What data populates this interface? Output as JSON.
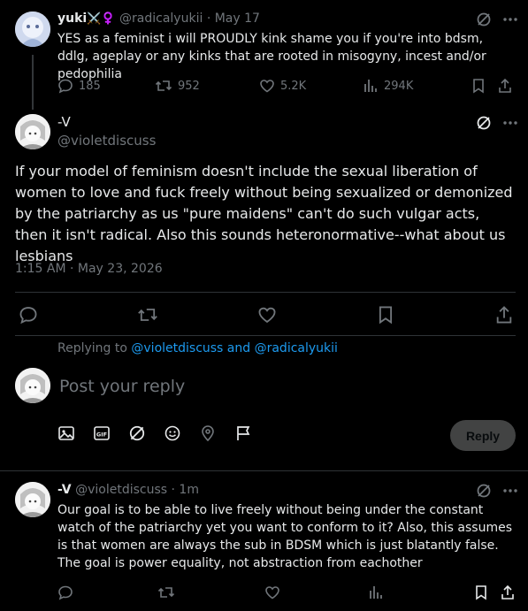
{
  "colors": {
    "background": "#000000",
    "text": "#e7e9ea",
    "muted": "#71767b",
    "accent": "#1d9bf0",
    "divider": "#2f3336"
  },
  "tweet1": {
    "name": "yuki",
    "name_emoji": "⚔️♀️",
    "handle": "@radicalyukii",
    "date": "May 17",
    "text": "YES as a feminist i will PROUDLY kink shame you if you're into bdsm, ddlg, ageplay or any kinks that are rooted in misogyny, incest and/or pedophilia",
    "replies": "185",
    "reposts": "952",
    "likes": "5.2K",
    "views": "294K",
    "icons": [
      "grok-icon",
      "more-icon",
      "reply-icon",
      "repost-icon",
      "like-icon",
      "views-icon",
      "bookmark-icon",
      "share-icon"
    ]
  },
  "main": {
    "name": "-V",
    "handle": "@violetdiscuss",
    "text": "If your model of feminism doesn't include the sexual liberation of women to love and fuck freely without being sexualized or demonized by the patriarchy as us \"pure maidens\" can't do such vulgar acts, then it isn't radical. Also this sounds heteronormative--what about us lesbians",
    "timestamp": "1:15 AM · May 23, 2026"
  },
  "compose": {
    "replying_prefix": "Replying to",
    "replying_to": "@violetdiscuss and @radicalyukii",
    "placeholder": "Post your reply",
    "reply_label": "Reply",
    "icons": [
      "image-icon",
      "gif-icon",
      "grok-icon",
      "emoji-icon",
      "location-icon",
      "flag-icon"
    ]
  },
  "tweet3": {
    "name": "-V",
    "handle": "@violetdiscuss",
    "time": "1m",
    "text": "Our goal is to be able to live freely without being under the constant watch of the patriarchy yet you want to conform to it? Also, this assumes is that women are always the sub in BDSM which is just blatantly false. The goal is power equality, not abstraction from eachother"
  }
}
